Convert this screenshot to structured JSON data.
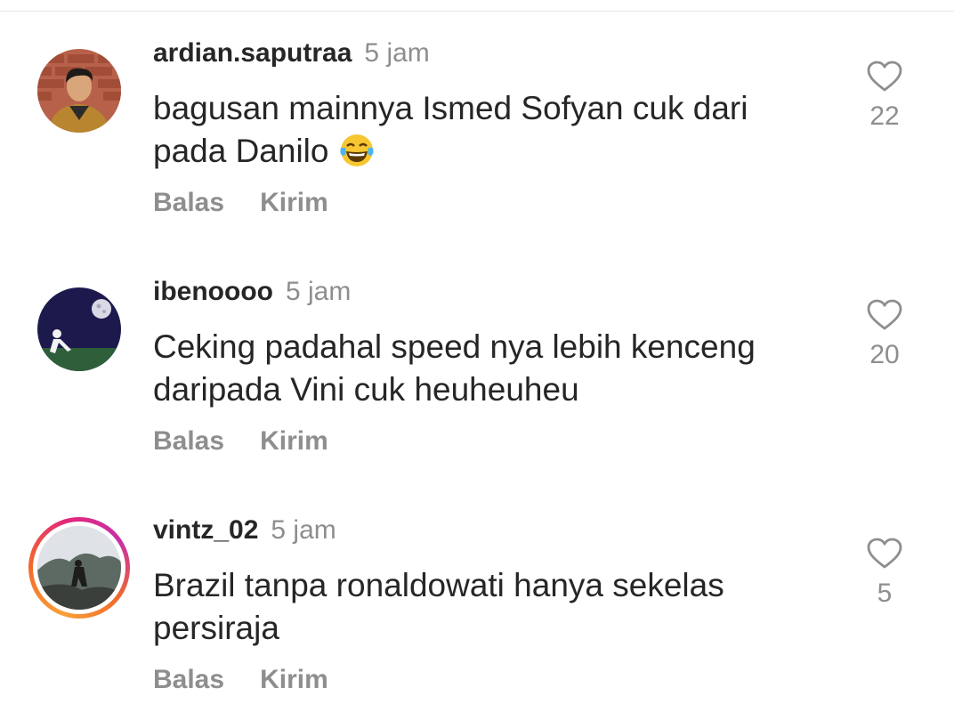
{
  "comments": [
    {
      "username": "ardian.saputraa",
      "time": "5 jam",
      "text": "bagusan mainnya Ismed Sofyan cuk dari pada Danilo",
      "emoji": "😂",
      "like_count": "22",
      "reply_label": "Balas",
      "send_label": "Kirim"
    },
    {
      "username": "ibenoooo",
      "time": "5 jam",
      "text": "Ceking padahal speed nya lebih kenceng daripada Vini cuk heuheuheu",
      "like_count": "20",
      "reply_label": "Balas",
      "send_label": "Kirim"
    },
    {
      "username": "vintz_02",
      "time": "5 jam",
      "text": "Brazil tanpa ronaldowati hanya sekelas persiraja",
      "like_count": "5",
      "reply_label": "Balas",
      "send_label": "Kirim"
    }
  ],
  "icons": {
    "like": "heart-outline-icon"
  },
  "colors": {
    "text": "#262626",
    "muted": "#8e8e8e",
    "story_ring": [
      "#f9a13a",
      "#e3287a",
      "#c72fa8"
    ]
  }
}
